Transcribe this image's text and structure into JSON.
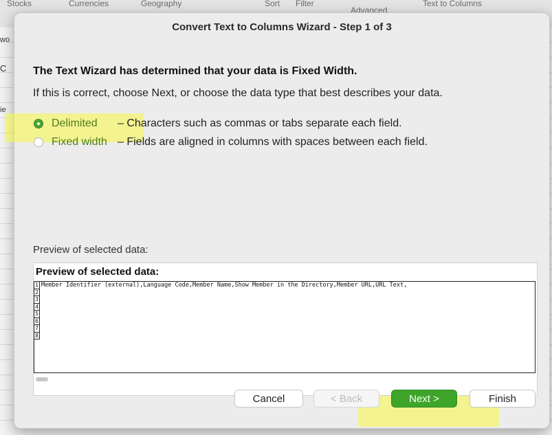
{
  "ribbon": {
    "tabs": [
      "Stocks",
      "Currencies",
      "Geography"
    ],
    "tools": [
      "Sort",
      "Filter",
      "Advanced",
      "Text to Columns"
    ]
  },
  "side_fragments": [
    "wo",
    "C",
    "ie"
  ],
  "dialog": {
    "title": "Convert Text to Columns Wizard - Step 1 of 3",
    "heading": "The Text Wizard has determined that your data is Fixed Width.",
    "subtext": "If this is correct, choose Next, or choose the data type that best describes your data.",
    "options": [
      {
        "label": "Delimited",
        "description": "– Characters such as commas or tabs separate each field.",
        "selected": true
      },
      {
        "label": "Fixed width",
        "description": "– Fields are aligned in columns with spaces between each field.",
        "selected": false
      }
    ],
    "preview_label": "Preview of selected data:",
    "preview_title": "Preview of selected data:",
    "preview_rows": [
      {
        "num": "1",
        "text": "Member Identifier (external),Language Code,Member Name,Show Member in the Directory,Member URL,URL Text,"
      },
      {
        "num": "2",
        "text": ""
      },
      {
        "num": "3",
        "text": ""
      },
      {
        "num": "4",
        "text": ""
      },
      {
        "num": "5",
        "text": ""
      },
      {
        "num": "6",
        "text": ""
      },
      {
        "num": "7",
        "text": ""
      },
      {
        "num": "8",
        "text": ""
      }
    ],
    "buttons": {
      "cancel": "Cancel",
      "back": "< Back",
      "next": "Next >",
      "finish": "Finish"
    }
  },
  "colors": {
    "accent": "#3ea52a",
    "highlight": "#fafa46"
  }
}
